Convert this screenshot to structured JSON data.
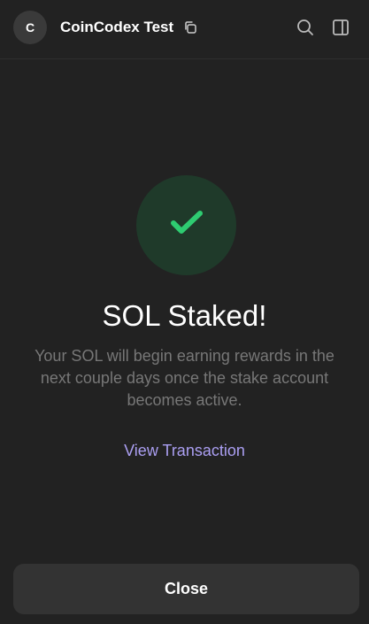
{
  "header": {
    "avatar_initial": "C",
    "account_name": "CoinCodex Test",
    "icons": [
      "copy-icon",
      "search-icon",
      "sidebar-toggle-icon"
    ]
  },
  "success": {
    "icon": "checkmark-icon",
    "title": "SOL Staked!",
    "description": "Your SOL will begin earning rewards in the next couple days once the stake account becomes active.",
    "link_label": "View Transaction"
  },
  "footer": {
    "close_label": "Close"
  },
  "colors": {
    "background": "#222222",
    "accent_link": "#ab9ff2",
    "success_green": "#2ecc71",
    "success_circle": "#1f3a2a",
    "button_bg": "#333333",
    "muted_text": "#777777"
  }
}
